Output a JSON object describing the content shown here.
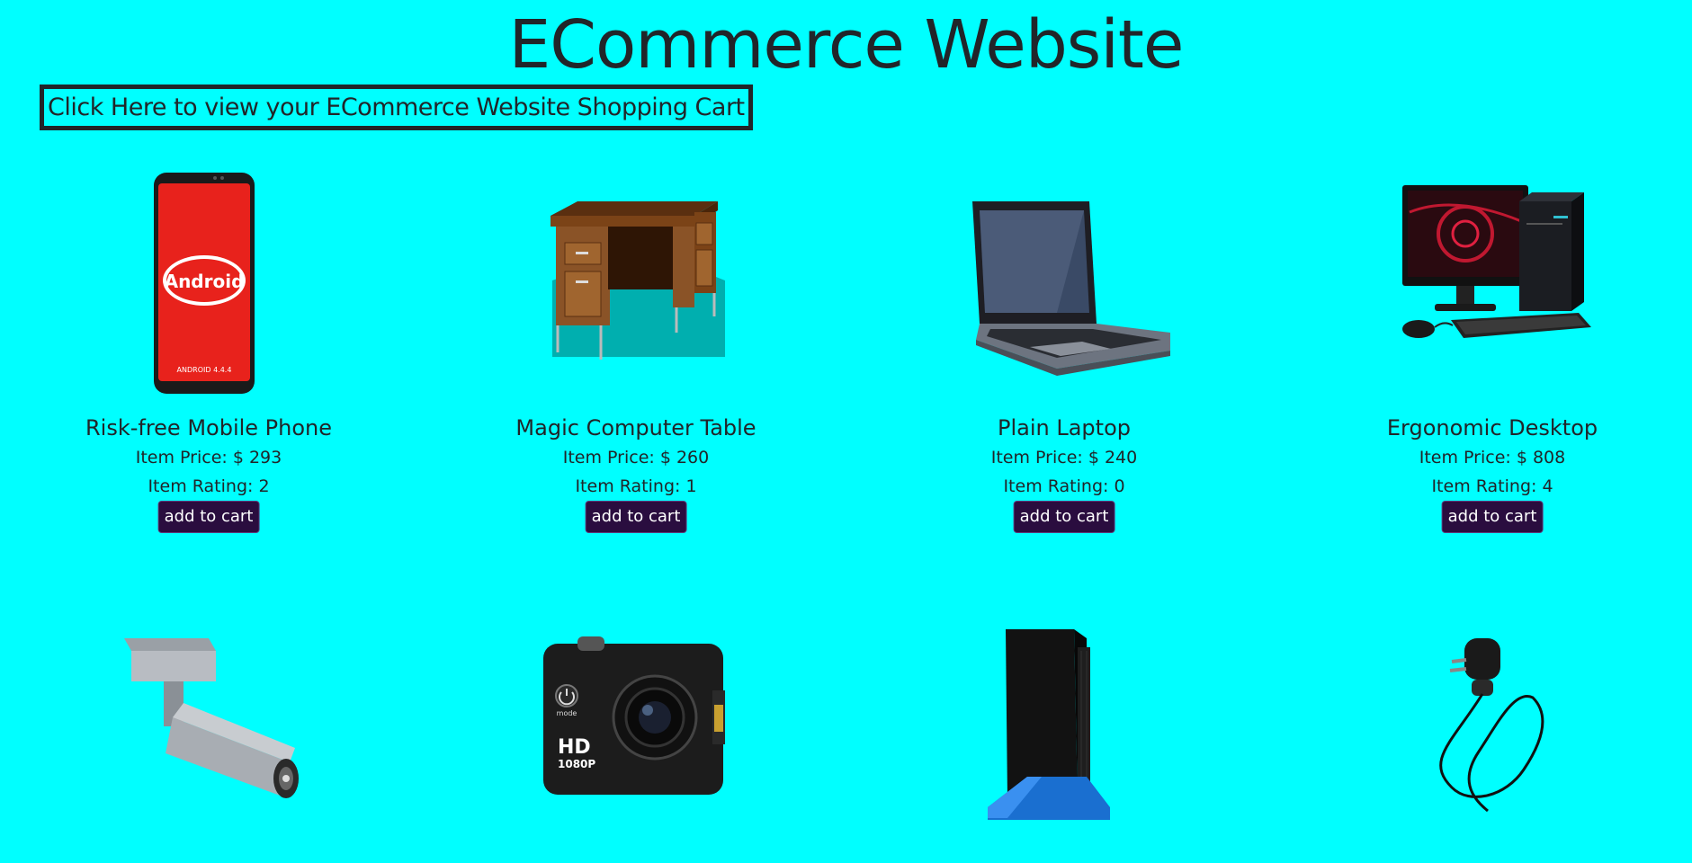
{
  "page": {
    "title": "ECommerce Website"
  },
  "cart_link": {
    "label": "Click Here to view your ECommerce Website Shopping Cart"
  },
  "products": [
    {
      "name": "Risk-free Mobile Phone",
      "price": "Item Price: $ 293",
      "rating": "Item Rating: 2",
      "button": "add to cart",
      "icon": "mobile-phone-image",
      "screen_text": "Android",
      "screen_version": "ANDROID 4.4.4"
    },
    {
      "name": "Magic Computer Table",
      "price": "Item Price: $ 260",
      "rating": "Item Rating: 1",
      "button": "add to cart",
      "icon": "computer-table-image"
    },
    {
      "name": "Plain Laptop",
      "price": "Item Price: $ 240",
      "rating": "Item Rating: 0",
      "button": "add to cart",
      "icon": "laptop-image"
    },
    {
      "name": "Ergonomic Desktop",
      "price": "Item Price: $ 808",
      "rating": "Item Rating: 4",
      "button": "add to cart",
      "icon": "desktop-computer-image"
    },
    {
      "icon": "security-camera-image"
    },
    {
      "icon": "action-camera-image",
      "label_hd": "HD",
      "label_res": "1080P",
      "label_mode": "mode"
    },
    {
      "icon": "game-console-image"
    },
    {
      "icon": "phone-charger-image"
    }
  ],
  "colors": {
    "background": "#00ffff",
    "text": "#212529",
    "button": "#2a0d3f"
  }
}
